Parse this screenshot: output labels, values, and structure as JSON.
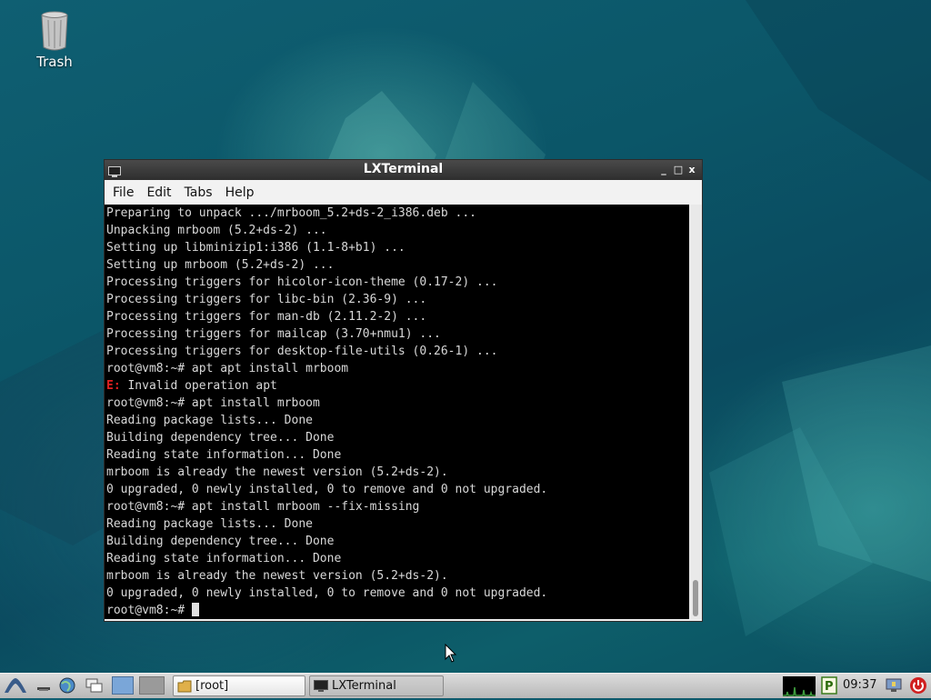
{
  "desktop": {
    "trash_label": "Trash"
  },
  "window": {
    "title": "LXTerminal",
    "controls": {
      "minimize": "_",
      "maximize": "□",
      "close": "x"
    },
    "menu": [
      "File",
      "Edit",
      "Tabs",
      "Help"
    ]
  },
  "terminal": {
    "lines": [
      "Preparing to unpack .../mrboom_5.2+ds-2_i386.deb ...",
      "Unpacking mrboom (5.2+ds-2) ...",
      "Setting up libminizip1:i386 (1.1-8+b1) ...",
      "Setting up mrboom (5.2+ds-2) ...",
      "Processing triggers for hicolor-icon-theme (0.17-2) ...",
      "Processing triggers for libc-bin (2.36-9) ...",
      "Processing triggers for man-db (2.11.2-2) ...",
      "Processing triggers for mailcap (3.70+nmu1) ...",
      "Processing triggers for desktop-file-utils (0.26-1) ...",
      "root@vm8:~# apt apt install mrboom"
    ],
    "error_prefix": "E:",
    "error_message": " Invalid operation apt",
    "lines_after": [
      "root@vm8:~# apt install mrboom",
      "Reading package lists... Done",
      "Building dependency tree... Done",
      "Reading state information... Done",
      "mrboom is already the newest version (5.2+ds-2).",
      "0 upgraded, 0 newly installed, 0 to remove and 0 not upgraded.",
      "root@vm8:~# apt install mrboom --fix-missing",
      "Reading package lists... Done",
      "Building dependency tree... Done",
      "Reading state information... Done",
      "mrboom is already the newest version (5.2+ds-2).",
      "0 upgraded, 0 newly installed, 0 to remove and 0 not upgraded."
    ],
    "prompt": "root@vm8:~# "
  },
  "taskbar": {
    "tasks": [
      {
        "label": "[root]",
        "icon": "folder-icon"
      },
      {
        "label": "LXTerminal",
        "icon": "terminal-icon"
      }
    ],
    "clock": "09:37",
    "colors": {
      "accent_green": "#3c9a3c",
      "power_red": "#d02020"
    }
  }
}
